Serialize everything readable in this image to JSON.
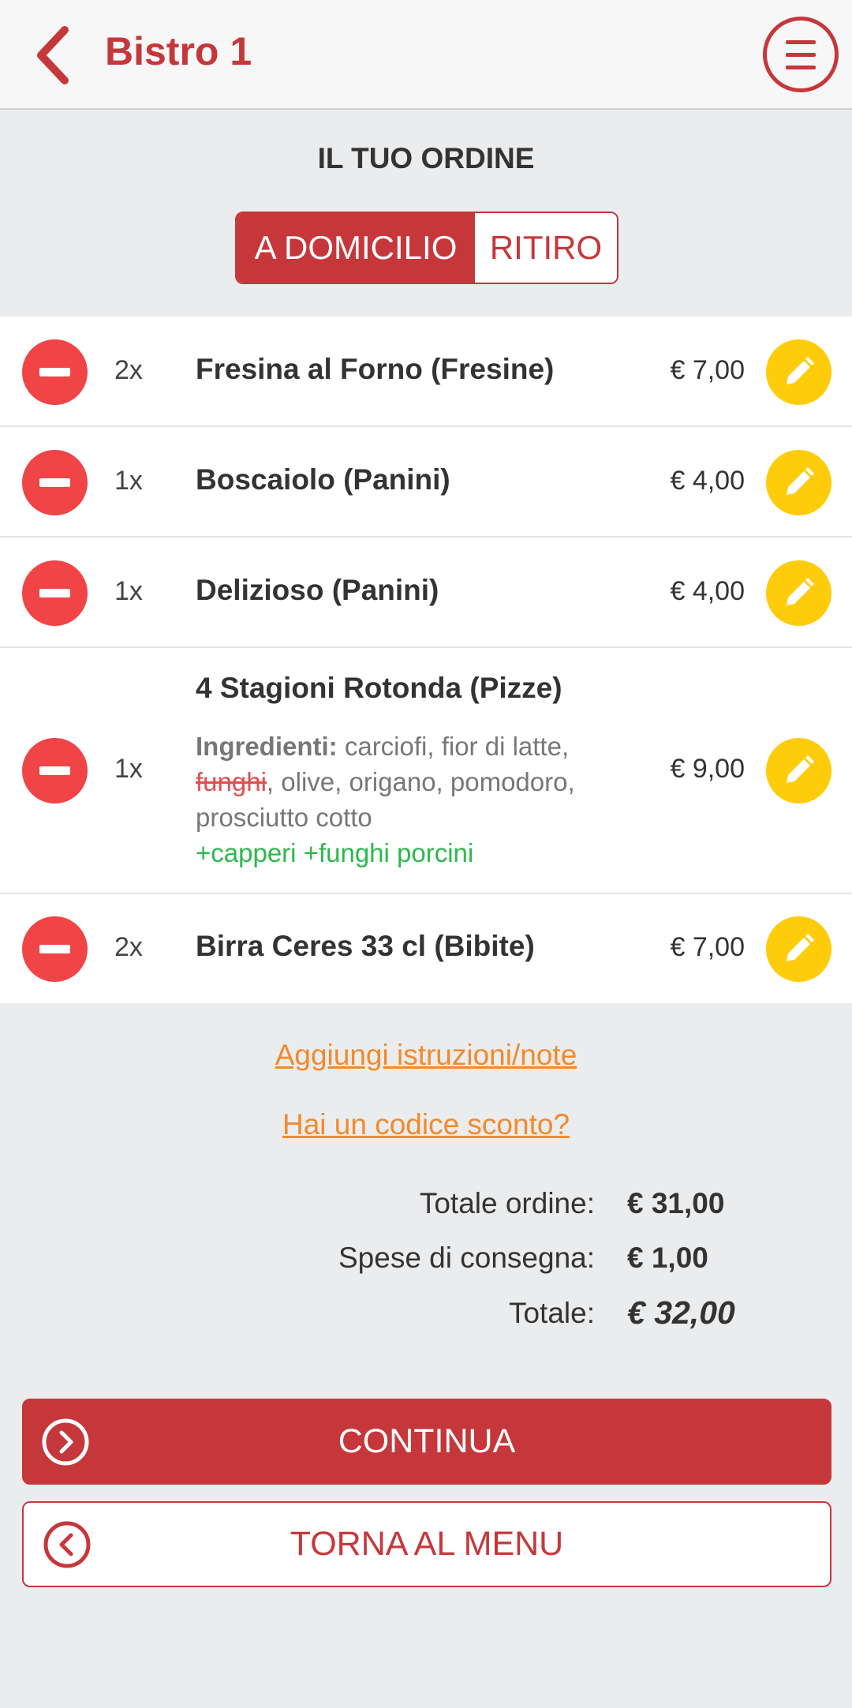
{
  "header": {
    "title": "Bistro 1",
    "back_icon": "chevron-left-icon",
    "menu_icon": "hamburger-menu-icon"
  },
  "order": {
    "title": "IL TUO ORDINE",
    "toggle": {
      "delivery_label": "A DOMICILIO",
      "pickup_label": "RITIRO",
      "selected": "A DOMICILIO"
    }
  },
  "items": [
    {
      "qty": "2x",
      "name": "Fresina al Forno (Fresine)",
      "price": "€ 7,00"
    },
    {
      "qty": "1x",
      "name": "Boscaiolo (Panini)",
      "price": "€ 4,00"
    },
    {
      "qty": "1x",
      "name": "Delizioso (Panini)",
      "price": "€ 4,00"
    },
    {
      "qty": "1x",
      "name": "4 Stagioni Rotonda (Pizze)",
      "price": "€ 9,00",
      "ingredients_label": "Ingredienti:",
      "ingredients_pre": " carciofi, fior di latte,",
      "ingredients_removed": "funghi",
      "ingredients_post": ", olive, origano, pomodoro, prosciutto cotto",
      "ingredients_added": "+capperi +funghi porcini"
    },
    {
      "qty": "2x",
      "name": "Birra Ceres 33 cl (Bibite)",
      "price": "€ 7,00"
    }
  ],
  "links": {
    "notes": "Aggiungi istruzioni/note",
    "discount": "Hai un codice sconto?"
  },
  "totals": {
    "order_label": "Totale ordine:",
    "order_value": "€ 31,00",
    "delivery_label": "Spese di consegna:",
    "delivery_value": "€ 1,00",
    "total_label": "Totale:",
    "total_value": "€ 32,00"
  },
  "buttons": {
    "continue": "CONTINUA",
    "back_to_menu": "TORNA AL MENU"
  },
  "colors": {
    "brand_red": "#c6373b",
    "remove_red": "#f04447",
    "edit_yellow": "#ffcc0c",
    "link_orange": "#f28a2b",
    "added_green": "#2db84d"
  }
}
